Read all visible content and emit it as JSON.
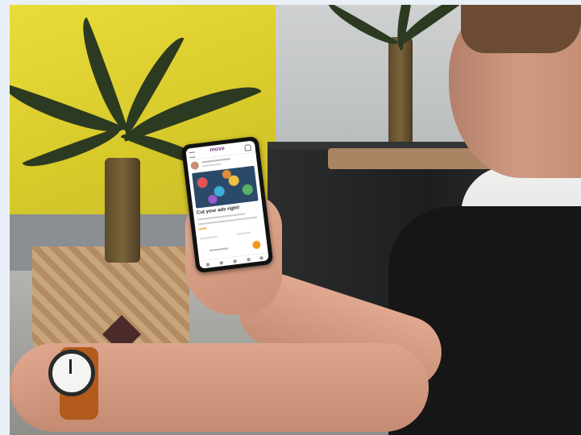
{
  "phone": {
    "app_name": "move",
    "post_title": "Cut your ads right!"
  },
  "icons": [
    "menu-icon",
    "bell-icon",
    "avatar",
    "floating-action-button"
  ],
  "colors": {
    "wall": "#e0d230",
    "shirt": "#161616",
    "watch_strap": "#b35a1d",
    "app_accent": "#f59a18",
    "brand": "#7a3c8c"
  }
}
